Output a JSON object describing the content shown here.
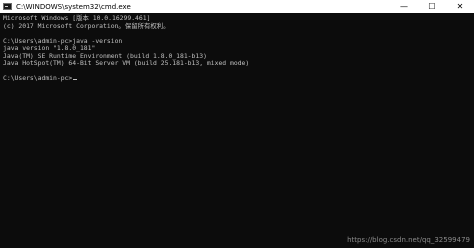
{
  "window": {
    "title": "C:\\WINDOWS\\system32\\cmd.exe",
    "minimize_glyph": "—",
    "maximize_glyph": "☐",
    "close_glyph": "✕"
  },
  "terminal": {
    "lines": [
      "Microsoft Windows [版本 10.0.16299.461]",
      "(c) 2017 Microsoft Corporation。保留所有权利。",
      "",
      "C:\\Users\\admin-pc>java -version",
      "java version \"1.8.0_181\"",
      "Java(TM) SE Runtime Environment (build 1.8.0_181-b13)",
      "Java HotSpot(TM) 64-Bit Server VM (build 25.181-b13, mixed mode)",
      "",
      "C:\\Users\\admin-pc>"
    ]
  },
  "watermark": "https://blog.csdn.net/qq_32599479"
}
